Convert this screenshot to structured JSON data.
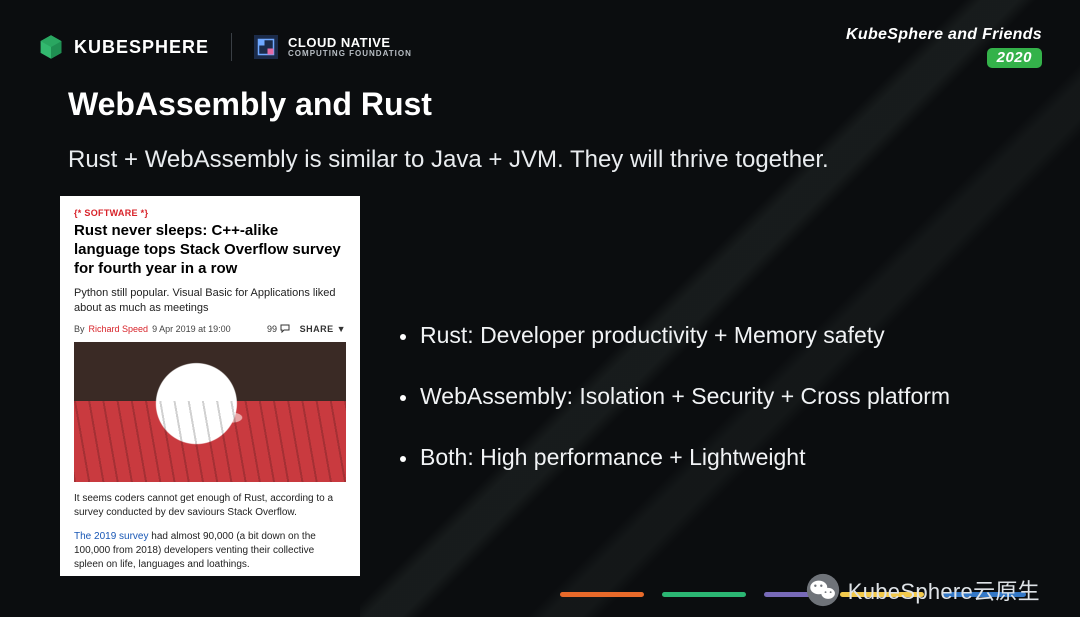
{
  "header": {
    "kubesphere_word": "KUBESPHERE",
    "cncf_line1": "CLOUD NATIVE",
    "cncf_line2": "COMPUTING FOUNDATION",
    "friends_line": "KubeSphere and Friends",
    "year_badge": "2020"
  },
  "title": "WebAssembly and Rust",
  "subtitle": "Rust + WebAssembly is similar to Java + JVM. They will thrive together.",
  "article": {
    "tag_open": "{*",
    "tag_word": "SOFTWARE",
    "tag_close": "*}",
    "headline": "Rust never sleeps: C++-alike language tops Stack Overflow survey for fourth year in a row",
    "deck": "Python still popular. Visual Basic for Applications liked about as much as meetings",
    "by_prefix": "By",
    "author": "Richard Speed",
    "date": "9 Apr 2019 at 19:00",
    "comment_count": "99",
    "share_label": "SHARE ▼",
    "para1": "It seems coders cannot get enough of Rust, according to a survey conducted by dev saviours Stack Overflow.",
    "para2_link": "The 2019 survey",
    "para2_rest": " had almost 90,000 (a bit down on the 100,000 from 2018) developers venting their collective spleen on life, languages and loathings."
  },
  "bullets": [
    "Rust: Developer productivity + Memory safety",
    "WebAssembly: Isolation + Security + Cross platform",
    "Both: High performance + Lightweight"
  ],
  "watermark": "KubeSphere云原生",
  "colors": {
    "accent_green": "#34b24a",
    "stripe_orange": "#e86a2a",
    "stripe_green": "#2bb673",
    "stripe_purple": "#8c7bd6",
    "stripe_yellow": "#f2c94c",
    "stripe_blue": "#3478c6"
  }
}
